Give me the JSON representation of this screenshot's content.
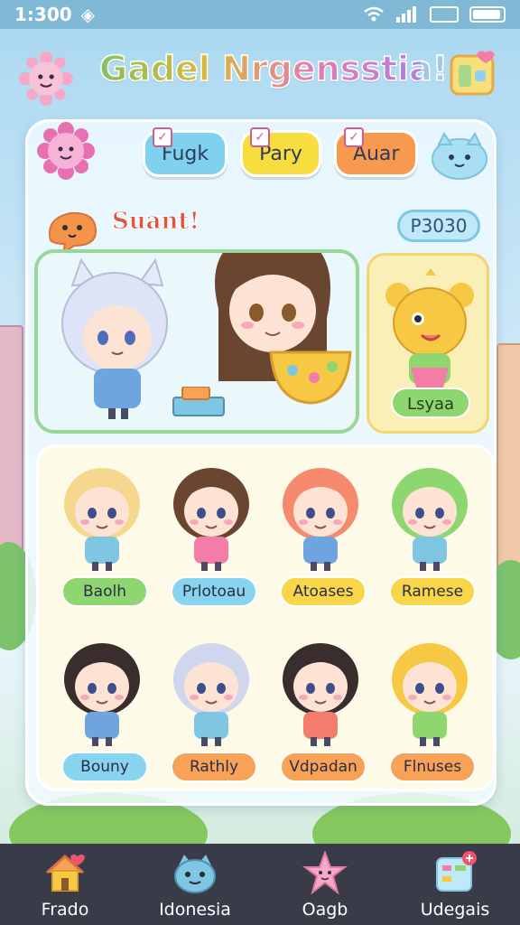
{
  "status_bar": {
    "time": "1:300"
  },
  "header": {
    "title": "Gadel Nrgensstia!"
  },
  "tabs": [
    {
      "label": "Fugk"
    },
    {
      "label": "Pary"
    },
    {
      "label": "Auar"
    }
  ],
  "section": {
    "title": "Suant!",
    "score": "P3030"
  },
  "featured": {
    "side_label": "Lsyaa"
  },
  "characters": [
    {
      "label": "Baolh",
      "color": "#8ed66f"
    },
    {
      "label": "Prlotoau",
      "color": "#88d4ee"
    },
    {
      "label": "Atoases",
      "color": "#f7d64a"
    },
    {
      "label": "Ramese",
      "color": "#f7d64a"
    },
    {
      "label": "Bouny",
      "color": "#88d4ee"
    },
    {
      "label": "Rathly",
      "color": "#f7a257"
    },
    {
      "label": "Vdpadan",
      "color": "#f7a257"
    },
    {
      "label": "Flnuses",
      "color": "#f7a257"
    }
  ],
  "bottom_nav": [
    {
      "label": "Frado",
      "icon": "home-icon"
    },
    {
      "label": "Idonesia",
      "icon": "cat-face-icon"
    },
    {
      "label": "Oagb",
      "icon": "star-icon"
    },
    {
      "label": "Udegais",
      "icon": "calendar-icon"
    }
  ]
}
